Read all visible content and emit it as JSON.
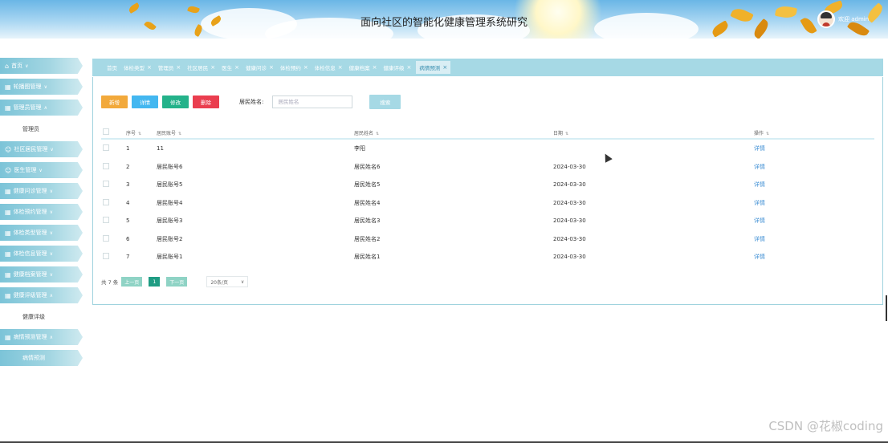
{
  "header": {
    "title": "面向社区的智能化健康管理系统研究",
    "user_label": "欢迎 admin"
  },
  "sidebar": {
    "items": [
      {
        "label": "首页",
        "icon": "home-icon",
        "arrow": "chevron-down-icon"
      },
      {
        "label": "轮播图管理",
        "icon": "grid-icon",
        "arrow": "chevron-down-icon"
      },
      {
        "label": "管理员管理",
        "icon": "grid-icon",
        "arrow": "chevron-up-icon"
      },
      {
        "label": "管理员",
        "sub": true
      },
      {
        "label": "社区居民管理",
        "icon": "user-icon",
        "arrow": "chevron-down-icon"
      },
      {
        "label": "医生管理",
        "icon": "user-icon",
        "arrow": "chevron-down-icon"
      },
      {
        "label": "健康问诊管理",
        "icon": "grid-icon",
        "arrow": "chevron-down-icon"
      },
      {
        "label": "体检预约管理",
        "icon": "grid-icon",
        "arrow": "chevron-down-icon"
      },
      {
        "label": "体检类型管理",
        "icon": "grid-icon",
        "arrow": "chevron-down-icon"
      },
      {
        "label": "体检信息管理",
        "icon": "grid-icon",
        "arrow": "chevron-down-icon"
      },
      {
        "label": "健康档案管理",
        "icon": "grid-icon",
        "arrow": "chevron-down-icon"
      },
      {
        "label": "健康评级管理",
        "icon": "grid-icon",
        "arrow": "chevron-up-icon"
      },
      {
        "label": "健康评级",
        "sub": true
      },
      {
        "label": "病情预测管理",
        "icon": "grid-icon",
        "arrow": "chevron-up-icon"
      },
      {
        "label": "病情预测",
        "sub": true,
        "active": true
      }
    ]
  },
  "tabs": [
    {
      "label": "首页"
    },
    {
      "label": "体检类型"
    },
    {
      "label": "管理员"
    },
    {
      "label": "社区居民"
    },
    {
      "label": "医生"
    },
    {
      "label": "健康问诊"
    },
    {
      "label": "体检预约"
    },
    {
      "label": "体检信息"
    },
    {
      "label": "健康档案"
    },
    {
      "label": "健康评级"
    },
    {
      "label": "病情预测",
      "active": true
    }
  ],
  "toolbar": {
    "add_label": "新增",
    "detail_label": "详情",
    "edit_label": "修改",
    "delete_label": "删除",
    "search_label": "居民姓名:",
    "search_placeholder": "居民姓名",
    "search_button": "搜索"
  },
  "table": {
    "headers": {
      "index": "序号",
      "account": "居民账号",
      "name": "居民姓名",
      "date": "日期",
      "op": "操作"
    },
    "rows": [
      {
        "index": "1",
        "account": "11",
        "name": "李阳",
        "date": "",
        "op": "详情"
      },
      {
        "index": "2",
        "account": "居民账号6",
        "name": "居民姓名6",
        "date": "2024-03-30",
        "op": "详情"
      },
      {
        "index": "3",
        "account": "居民账号5",
        "name": "居民姓名5",
        "date": "2024-03-30",
        "op": "详情"
      },
      {
        "index": "4",
        "account": "居民账号4",
        "name": "居民姓名4",
        "date": "2024-03-30",
        "op": "详情"
      },
      {
        "index": "5",
        "account": "居民账号3",
        "name": "居民姓名3",
        "date": "2024-03-30",
        "op": "详情"
      },
      {
        "index": "6",
        "account": "居民账号2",
        "name": "居民姓名2",
        "date": "2024-03-30",
        "op": "详情"
      },
      {
        "index": "7",
        "account": "居民账号1",
        "name": "居民姓名1",
        "date": "2024-03-30",
        "op": "详情"
      }
    ]
  },
  "pager": {
    "total": "共 7 条",
    "prev": "上一页",
    "current": "1",
    "next": "下一页",
    "page_size": "20条/页"
  },
  "watermark": "CSDN @花椒coding",
  "colors": {
    "accent": "#a6d9e5",
    "add": "#f2a93b",
    "detail": "#43b7f0",
    "edit": "#24b28a",
    "delete": "#ea3e4f",
    "link": "#3d8ed4"
  }
}
